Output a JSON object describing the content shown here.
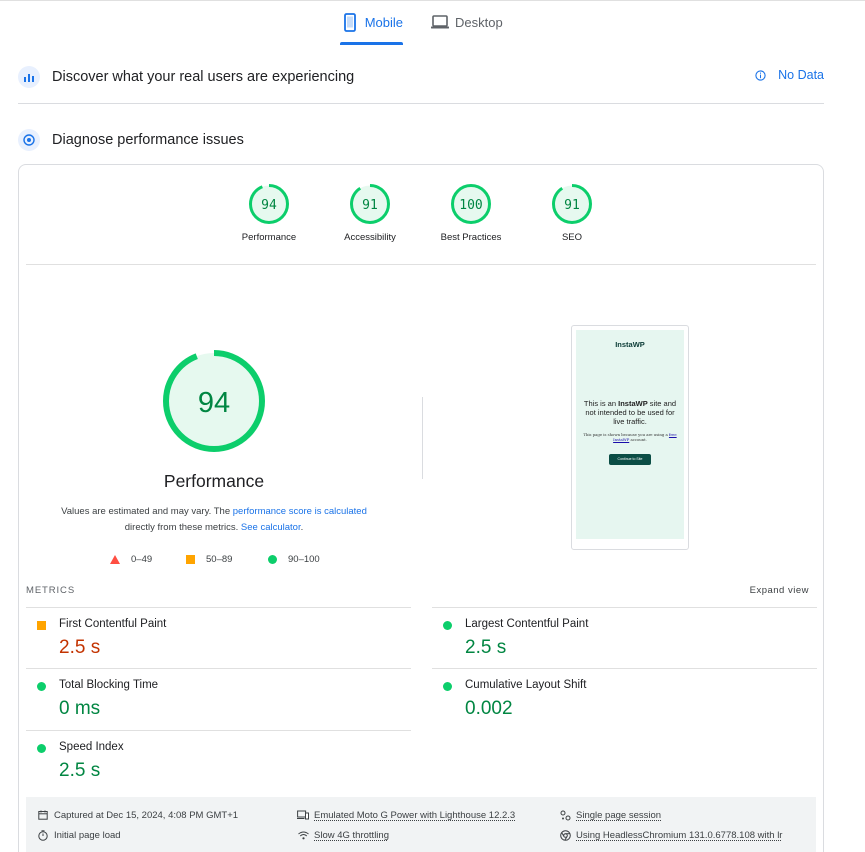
{
  "tabs": [
    {
      "label": "Mobile",
      "active": true,
      "icon": "smartphone-icon"
    },
    {
      "label": "Desktop",
      "active": false,
      "icon": "laptop-icon"
    }
  ],
  "crux_section": {
    "title": "Discover what your real users are experiencing",
    "status": "No Data"
  },
  "diagnose_section": {
    "title": "Diagnose performance issues"
  },
  "category_scores": [
    {
      "label": "Performance",
      "score": 94
    },
    {
      "label": "Accessibility",
      "score": 91
    },
    {
      "label": "Best Practices",
      "score": 100
    },
    {
      "label": "SEO",
      "score": 91
    }
  ],
  "performance": {
    "score": 94,
    "title": "Performance",
    "desc_1": "Values are estimated and may vary. The ",
    "desc_link_1": "performance score is calculated",
    "desc_2": "directly from these metrics. ",
    "desc_link_2": "See calculator",
    "desc_3": "."
  },
  "legend": [
    {
      "range": "0–49",
      "color": "#ff4e42",
      "shape": "triangle"
    },
    {
      "range": "50–89",
      "color": "#ffa400",
      "shape": "square"
    },
    {
      "range": "90–100",
      "color": "#0cce6b",
      "shape": "circle"
    }
  ],
  "screenshot": {
    "logo": "InstaWP",
    "heading_1": "This is an ",
    "heading_bold": "InstaWP",
    "heading_2": " site and not intended to be used for live traffic.",
    "small_1": "This page is shown because you are using a ",
    "small_link": "free InstaWP",
    "small_2": " account.",
    "button": "Continue to Site"
  },
  "metrics": {
    "header": "METRICS",
    "expand_label": "Expand view",
    "items": [
      {
        "label": "First Contentful Paint",
        "value": "2.5 s",
        "rating": "average"
      },
      {
        "label": "Largest Contentful Paint",
        "value": "2.5 s",
        "rating": "good"
      },
      {
        "label": "Total Blocking Time",
        "value": "0 ms",
        "rating": "good"
      },
      {
        "label": "Cumulative Layout Shift",
        "value": "0.002",
        "rating": "good"
      },
      {
        "label": "Speed Index",
        "value": "2.5 s",
        "rating": "good"
      }
    ]
  },
  "footer": {
    "captured": "Captured at Dec 15, 2024, 4:08 PM GMT+1",
    "initial_load": "Initial page load",
    "device": "Emulated Moto G Power with Lighthouse 12.2.3",
    "throttling": "Slow 4G throttling",
    "session": "Single page session",
    "browser": "Using HeadlessChromium 131.0.6778.108 with lr"
  },
  "colors": {
    "good": "#0cce6b",
    "average": "#ffa400",
    "poor": "#ff4e42",
    "accent": "#1a73e8"
  }
}
